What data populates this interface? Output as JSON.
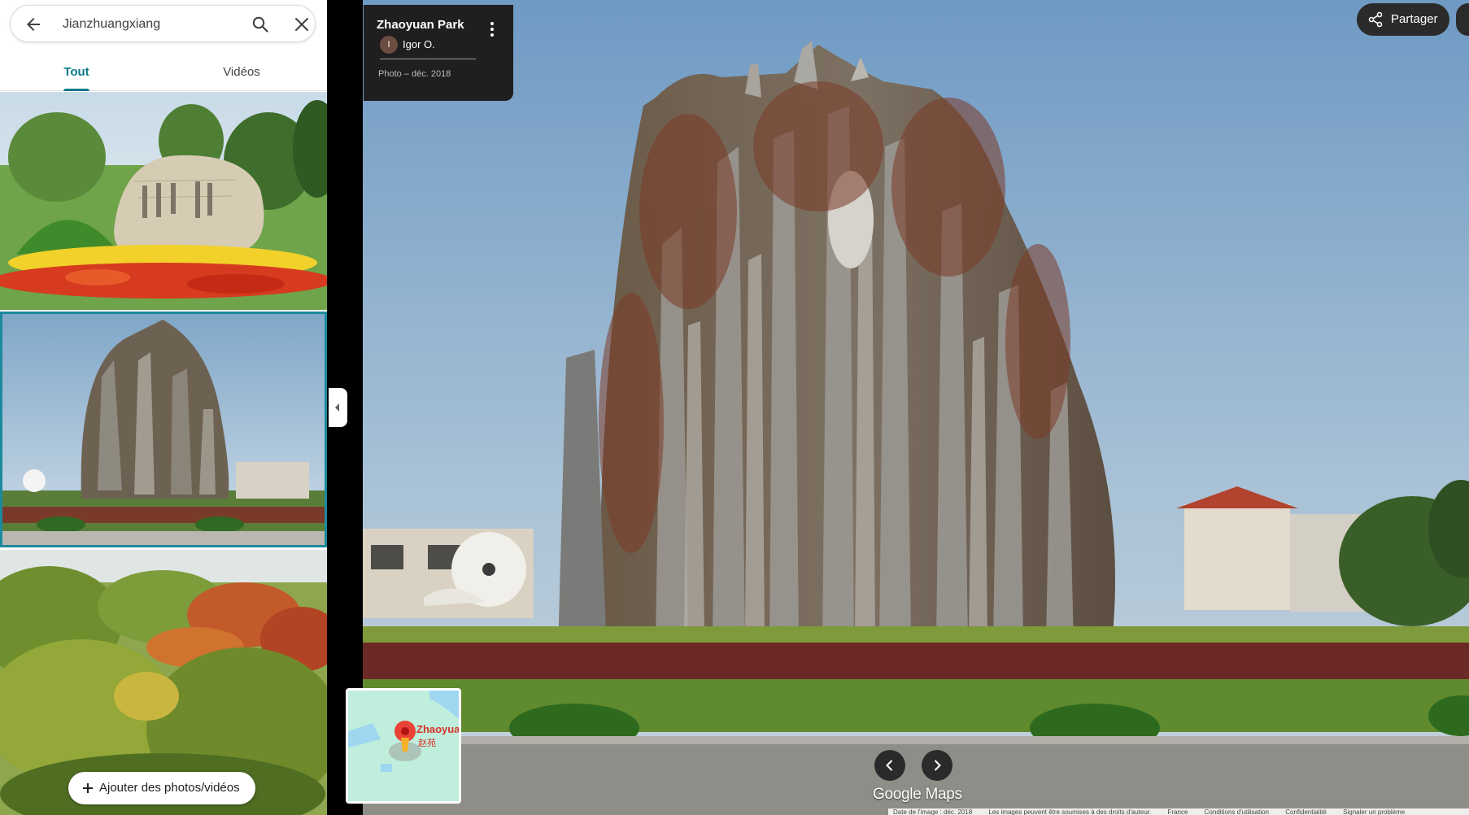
{
  "search": {
    "query": "Jianzhuangxiang",
    "icons": [
      "back-arrow-icon",
      "search-icon",
      "close-icon"
    ]
  },
  "tabs": [
    {
      "label": "Tout",
      "active": true
    },
    {
      "label": "Vidéos",
      "active": false
    }
  ],
  "add_button": {
    "label": "Ajouter des photos/vidéos",
    "icon": "plus-icon"
  },
  "info_card": {
    "title": "Zhaoyuan Park",
    "author_initial": "I",
    "author": "Igor O.",
    "date": "Photo – déc. 2018"
  },
  "share": {
    "label": "Partager",
    "icon": "share-icon"
  },
  "minimap": {
    "label": "Zhaoyua",
    "label_cn": "赵苑"
  },
  "logo": "Google Maps",
  "footer": {
    "items": [
      "Date de l'image : déc. 2018",
      "Les images peuvent être soumises à des droits d'auteur.",
      "France",
      "Conditions d'utilisation",
      "Confidentialité",
      "Signaler un problème"
    ]
  },
  "colors": {
    "accent": "#0b7a8a",
    "panel_bg": "#ffffff",
    "card_bg": "#1f1f1f",
    "selected_outline": "#1b8a9c"
  }
}
